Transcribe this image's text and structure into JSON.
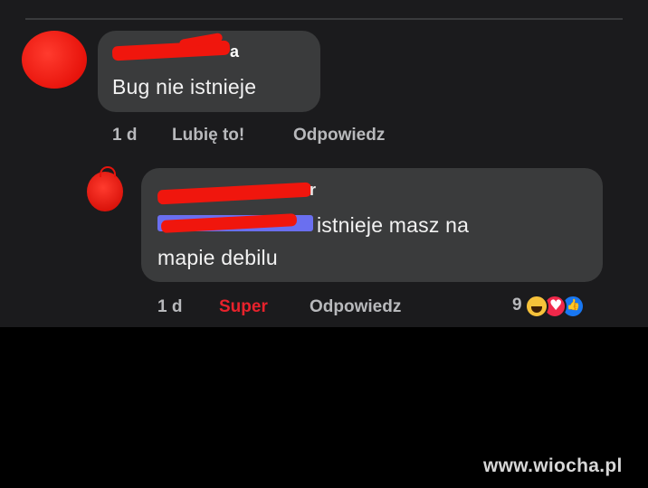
{
  "comment": {
    "author_fragment": "a",
    "text": "Bug nie istnieje",
    "age": "1 d",
    "like_label": "Lubię to!",
    "reply_label": "Odpowiedz"
  },
  "reply": {
    "author_fragment": "r",
    "text_line1": "istnieje masz na",
    "text_line2": "mapie debilu",
    "age": "1 d",
    "reaction_label": "Super",
    "reply_label": "Odpowiedz",
    "reaction_count": "9",
    "reaction_icons": [
      "haha-icon",
      "love-icon",
      "like-icon"
    ]
  },
  "watermark": "www.wiocha.pl",
  "colors": {
    "background": "#1b1b1d",
    "bubble": "#3a3b3c",
    "redaction": "#f0160d",
    "super_reaction": "#e8222c"
  }
}
